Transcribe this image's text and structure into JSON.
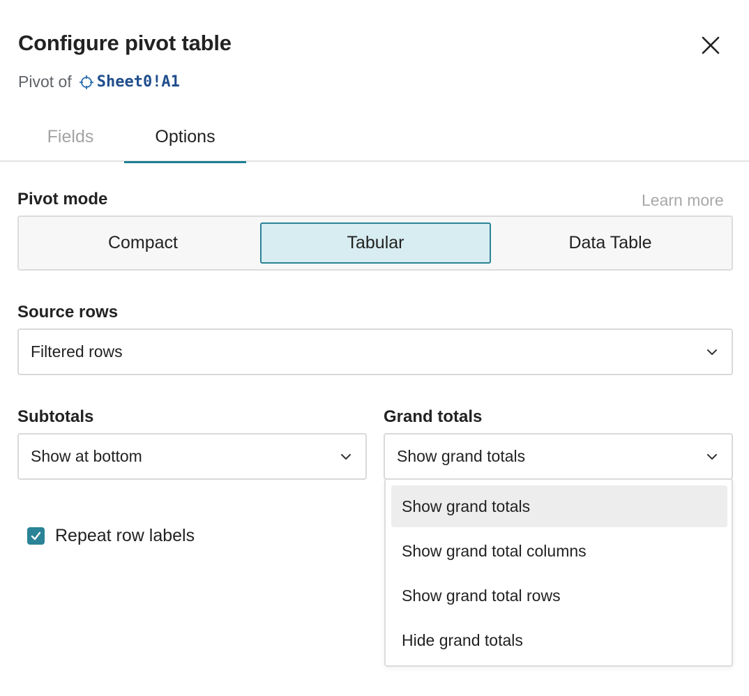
{
  "header": {
    "title": "Configure pivot table",
    "subtitle_prefix": "Pivot of",
    "source_ref": "Sheet0!A1",
    "close_icon": "close-icon",
    "ref_icon": "crosshair-icon"
  },
  "tabs": [
    {
      "label": "Fields",
      "active": false
    },
    {
      "label": "Options",
      "active": true
    }
  ],
  "pivot_mode": {
    "label": "Pivot mode",
    "learn_more": "Learn more",
    "options": [
      "Compact",
      "Tabular",
      "Data Table"
    ],
    "selected": "Tabular"
  },
  "source_rows": {
    "label": "Source rows",
    "value": "Filtered rows"
  },
  "subtotals": {
    "label": "Subtotals",
    "value": "Show at bottom"
  },
  "grand_totals": {
    "label": "Grand totals",
    "value": "Show grand totals",
    "options": [
      "Show grand totals",
      "Show grand total columns",
      "Show grand total rows",
      "Hide grand totals"
    ]
  },
  "repeat_row_labels": {
    "label": "Repeat row labels",
    "checked": true
  },
  "colors": {
    "accent": "#2a8396",
    "selected_bg": "#d7edf1",
    "ref_text": "#1f4e8c"
  }
}
